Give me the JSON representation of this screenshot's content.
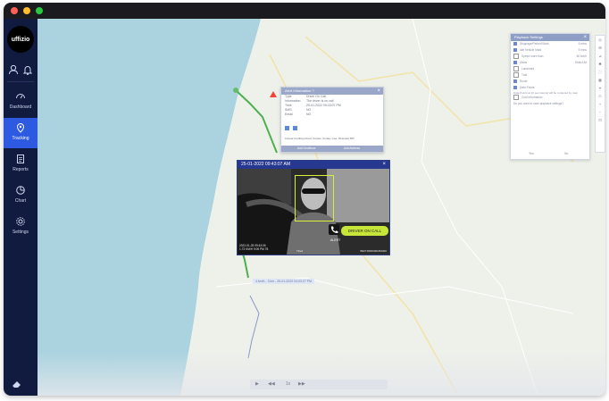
{
  "app": {
    "logo_text": "uffizio"
  },
  "sidebar": {
    "items": [
      {
        "label": "Dashboard",
        "icon": "speedometer-icon"
      },
      {
        "label": "Tracking",
        "icon": "location-pin-icon",
        "active": true
      },
      {
        "label": "Reports",
        "icon": "report-doc-icon"
      },
      {
        "label": "Chart",
        "icon": "pie-chart-icon"
      },
      {
        "label": "Settings",
        "icon": "gear-icon"
      }
    ]
  },
  "alert_popup": {
    "title": "Alert Information ?",
    "rows": [
      {
        "label": "Type",
        "value": "Driver On Call"
      },
      {
        "label": "Information",
        "value": "The driver is on call"
      },
      {
        "label": "Time",
        "value": "25-01-2022 09:43:07 PM"
      },
      {
        "label": "SMS",
        "value": "NO"
      },
      {
        "label": "Email",
        "value": "NO"
      }
    ],
    "location": "Karwar-Kodibag Road, Karwar, Kerala, Goa, Dharwad 583",
    "buttons": [
      "Add Geofence",
      "Add Address"
    ]
  },
  "video": {
    "title": "25-01-2022 09:43:07 AM",
    "badge": "DRIVER ON CALL",
    "alert": "ALERT",
    "stamp_line1": "2022-01-25 09:43:06",
    "stamp_line2": "1.73 KM/H   9:05 PM 78",
    "mid_text": "Tilted",
    "right_text": "B6271800000UB2000"
  },
  "route_label": "4 km/h - 3 km - 25-01-2022 04:03:27 PM",
  "playback": {
    "title": "Playback Settings",
    "options": [
      {
        "label": "Stoppage/Parked Mark",
        "checked": true,
        "right": "5 mins"
      },
      {
        "label": "Idle Vehicle Mark",
        "checked": true,
        "right": "5 mins"
      },
      {
        "label": "Speed more than",
        "checked": false,
        "right": "60 km/h"
      },
      {
        "label": "Alerts",
        "checked": true,
        "right": "Select All"
      },
      {
        "label": "Landmark",
        "checked": false,
        "right": ""
      },
      {
        "label": "Trail",
        "checked": false,
        "right": ""
      },
      {
        "label": "Route",
        "checked": true,
        "right": ""
      },
      {
        "label": "Data Points",
        "checked": true,
        "right": ""
      },
      {
        "label": "Cold Information",
        "checked": false,
        "right": ""
      }
    ],
    "note": "Data Points at 10 sec interval will be rendered by map",
    "question": "Do you want to save playback settings?",
    "yes": "Yes",
    "no": "No"
  },
  "map_tools": [
    "◎",
    "⊞",
    "⊿",
    "✱",
    "⛶",
    "▦",
    "⌖",
    "♺",
    "+",
    "−",
    "⊡"
  ],
  "bottom_bar": [
    "▶",
    "◀◀",
    "1x",
    "▶▶"
  ]
}
